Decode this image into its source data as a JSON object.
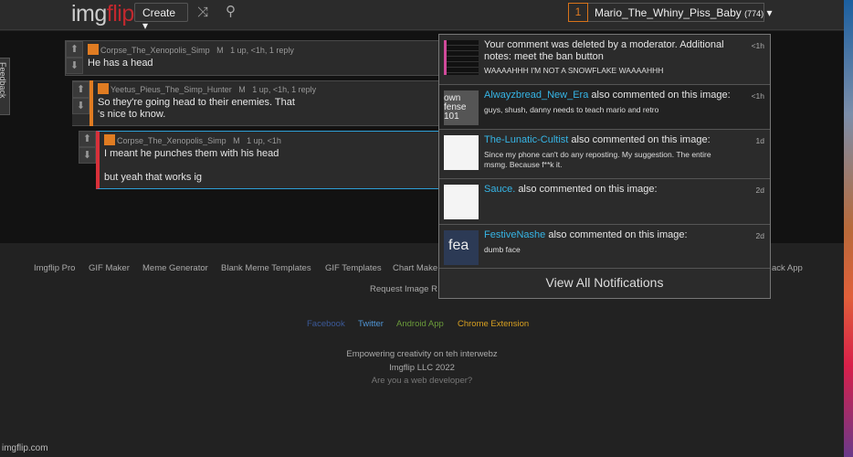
{
  "header": {
    "logo_a": "img",
    "logo_b": "flip",
    "create": "Create ▾",
    "notif_count": "1",
    "username": "Mario_The_Whiny_Piss_Baby",
    "points": "(774)",
    "caret": "▾"
  },
  "feedback": "Feedback",
  "comments": [
    {
      "author": "Corpse_The_Xenopolis_Simp",
      "badge": "M",
      "info": "1 up, <1h, 1 reply",
      "text": "He has a head"
    },
    {
      "author": "Yeetus_Pieus_The_Simp_Hunter",
      "badge": "M",
      "info": "1 up, <1h, 1 reply",
      "text": "So they're going head to their enemies. That 's nice to know."
    },
    {
      "author": "Corpse_The_Xenopolis_Simp",
      "badge": "M",
      "info": "1 up, <1h",
      "text1": "I meant he punches them with his head",
      "text2": "but yeah that works ig"
    }
  ],
  "notifications": [
    {
      "title": "Your comment was deleted by a moderator. Additional notes: meet the ban button",
      "sub": "WAAAAHHH I'M NOT A SNOWFLAKE WAAAAHHH",
      "age": "<1h"
    },
    {
      "user": "Alwayzbread_New_Era",
      "action": "also commented on this image:",
      "sub": "guys, shush, danny needs to teach mario and retro",
      "age": "<1h",
      "thumb_text": "own fense 101"
    },
    {
      "user": "The-Lunatic-Cultist",
      "action": "also commented on this image:",
      "sub": "Since my phone can't do any reposting. My suggestion. The entire msmg. Because f**k it.",
      "age": "1d"
    },
    {
      "user": "Sauce.",
      "action": "also commented on this image:",
      "sub": "",
      "age": "2d"
    },
    {
      "user": "FestiveNashe",
      "action": "also commented on this image:",
      "sub": "dumb face",
      "age": "2d",
      "thumb_text": "fea"
    }
  ],
  "view_all": "View All Notifications",
  "footer": {
    "links": [
      "Imgflip Pro",
      "GIF Maker",
      "Meme Generator",
      "Blank Meme Templates",
      "GIF Templates",
      "Chart Make"
    ],
    "right_link": "ack App",
    "request": "Request Image R",
    "social": [
      {
        "label": "Facebook",
        "color": "#3b5998"
      },
      {
        "label": "Twitter",
        "color": "#4f94d4"
      },
      {
        "label": "Android App",
        "color": "#6a9a3a"
      },
      {
        "label": "Chrome Extension",
        "color": "#d8a020"
      }
    ],
    "tagline": "Empowering creativity on teh interwebz",
    "copyright": "Imgflip LLC 2022",
    "dev": "Are you a web developer?"
  },
  "status_url": "imgflip.com"
}
